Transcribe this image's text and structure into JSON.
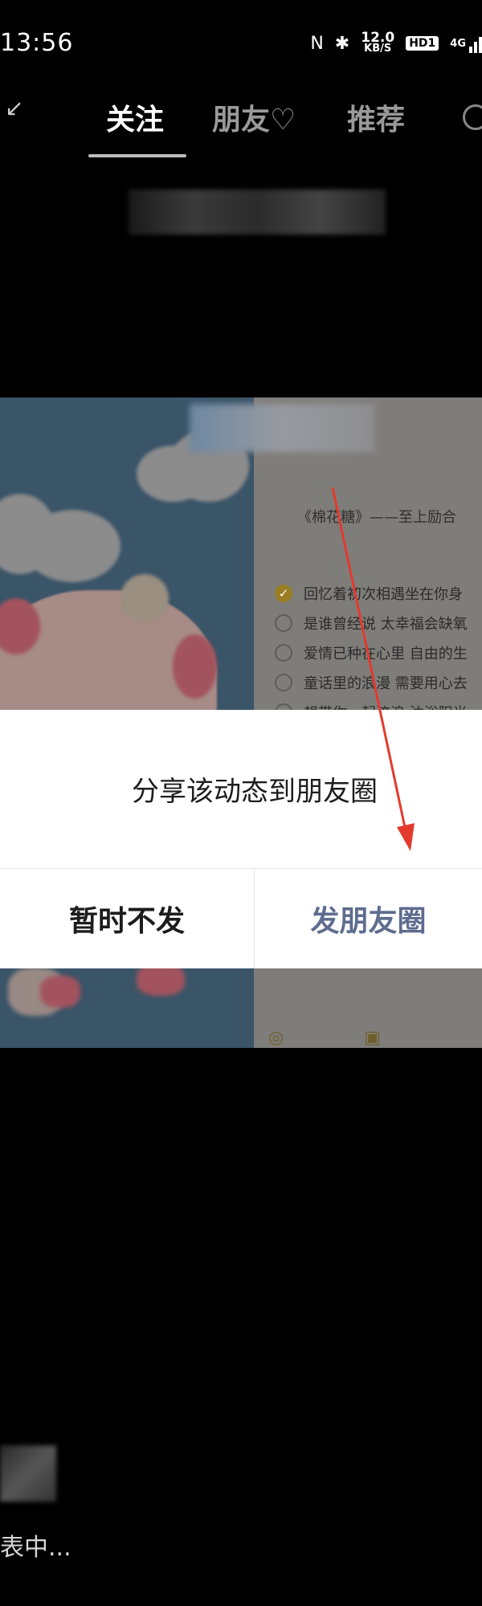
{
  "status_bar": {
    "time": "13:56",
    "nfc_icon": "N",
    "bluetooth_icon": "✱",
    "speed_value": "12.0",
    "speed_unit": "KB/S",
    "hd_badge": "HD1",
    "network": "4G"
  },
  "nav": {
    "tabs": [
      {
        "label": "关注",
        "active": true
      },
      {
        "label": "朋友♡",
        "active": false
      },
      {
        "label": "推荐",
        "active": false
      }
    ]
  },
  "post": {
    "note_title": "《棉花糖》——至上励合",
    "checklist": [
      {
        "text": "回忆着初次相遇坐在你身",
        "checked": true
      },
      {
        "text": "是谁曾经说 太幸福会缺氧",
        "checked": false
      },
      {
        "text": "爱情已种在心里 自由的生",
        "checked": false
      },
      {
        "text": "童话里的浪漫 需要用心去",
        "checked": false
      },
      {
        "text": "想带你一起流浪 沐浴阳光",
        "checked": false
      }
    ]
  },
  "dialog": {
    "message": "分享该动态到朋友圈",
    "cancel_label": "暂时不发",
    "confirm_label": "发朋友圈"
  },
  "bottom": {
    "status_text": "表中..."
  },
  "colors": {
    "confirm_text": "#5d6c8f",
    "arrow": "#e33a2e",
    "check_accent": "#9a7d22"
  }
}
